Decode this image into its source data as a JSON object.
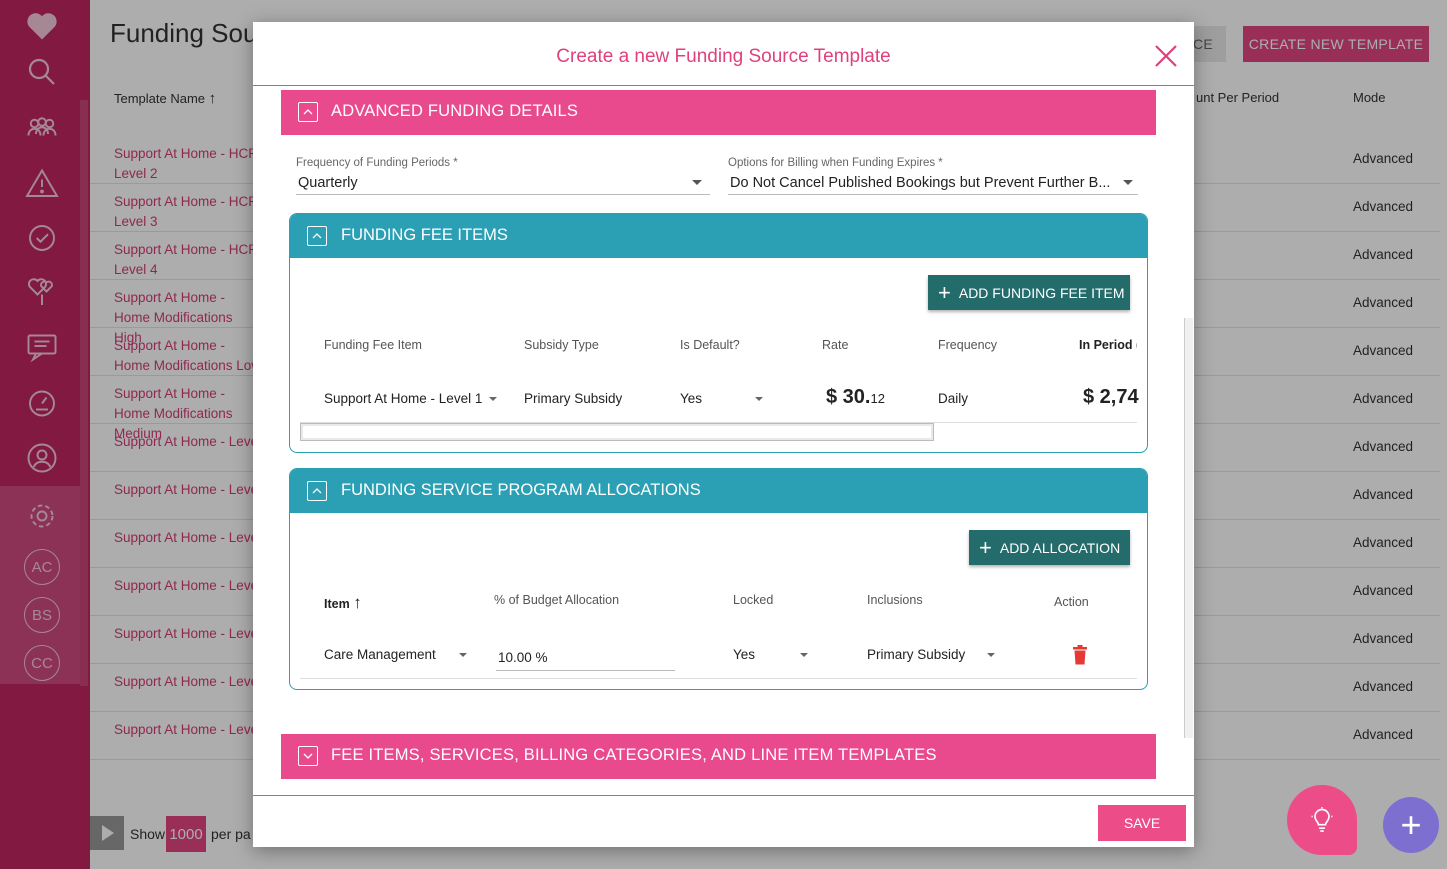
{
  "background": {
    "page_title": "Funding Sou",
    "header_buttons": {
      "new_source": "CE",
      "new_template": "CREATE NEW TEMPLATE"
    },
    "columns": {
      "template_name": "Template Name",
      "amount": "unt Per Period",
      "mode": "Mode"
    },
    "sidebar_circles": [
      "AC",
      "BS",
      "CC"
    ],
    "rows": [
      {
        "name": "Support At Home - HCP Level 2",
        "mode": "Advanced"
      },
      {
        "name": "Support At Home - HCP Level 3",
        "mode": "Advanced"
      },
      {
        "name": "Support At Home - HCP Level 4",
        "mode": "Advanced"
      },
      {
        "name": "Support At Home - Home Modifications High",
        "mode": "Advanced"
      },
      {
        "name": "Support At Home - Home Modifications Low",
        "mode": "Advanced"
      },
      {
        "name": "Support At Home - Home Modifications Medium",
        "mode": "Advanced"
      },
      {
        "name": "Support At Home - Level",
        "mode": "Advanced"
      },
      {
        "name": "Support At Home - Level",
        "mode": "Advanced"
      },
      {
        "name": "Support At Home - Level",
        "mode": "Advanced"
      },
      {
        "name": "Support At Home - Level",
        "mode": "Advanced"
      },
      {
        "name": "Support At Home - Level",
        "mode": "Advanced"
      },
      {
        "name": "Support At Home - Level",
        "mode": "Advanced"
      },
      {
        "name": "Support At Home - Level",
        "mode": "Advanced"
      }
    ],
    "pager": {
      "show": "Show",
      "count": "1000",
      "per_page": "per pa"
    }
  },
  "modal": {
    "title": "Create a new Funding Source Template",
    "save_label": "SAVE",
    "advanced_section": "ADVANCED FUNDING DETAILS",
    "frequency_label": "Frequency of Funding Periods *",
    "frequency_value": "Quarterly",
    "billing_label": "Options for Billing when Funding Expires *",
    "billing_value": "Do Not Cancel Published Bookings but Prevent Further B...",
    "fee_items": {
      "title": "FUNDING FEE ITEMS",
      "add_button": "ADD FUNDING FEE ITEM",
      "headers": [
        "Funding Fee Item",
        "Subsidy Type",
        "Is Default?",
        "Rate",
        "Frequency",
        "In Period ("
      ],
      "row": {
        "item": "Support At Home - Level 1",
        "subsidy": "Primary Subsidy",
        "is_default": "Yes",
        "rate_main": "$ 30.",
        "rate_cents": "12",
        "frequency": "Daily",
        "in_period": "$ 2,74"
      }
    },
    "allocations": {
      "title": "FUNDING SERVICE PROGRAM ALLOCATIONS",
      "add_button": "ADD ALLOCATION",
      "headers": [
        "Item",
        "% of Budget Allocation",
        "Locked",
        "Inclusions",
        "Action"
      ],
      "row": {
        "item": "Care Management",
        "budget": "10.00 %",
        "locked": "Yes",
        "inclusions": "Primary Subsidy"
      }
    },
    "fee_items_section": "FEE ITEMS, SERVICES, BILLING CATEGORIES, AND LINE ITEM TEMPLATES"
  },
  "colors": {
    "pink": "#e84a8d",
    "teal": "#2b9fb4",
    "teal_dark": "#246b6c",
    "sidebar": "#c0255f",
    "delete": "#e53935"
  },
  "icons": [
    "heart-icon",
    "search-icon",
    "users-icon",
    "warning-icon",
    "clock-check-icon",
    "hearts-icon",
    "chat-icon",
    "dashboard-icon",
    "user-icon",
    "gear-icon",
    "close-icon",
    "chevron-up-icon",
    "chevron-down-icon",
    "sort-up-icon",
    "trash-icon",
    "lightbulb-icon",
    "plus-icon"
  ]
}
